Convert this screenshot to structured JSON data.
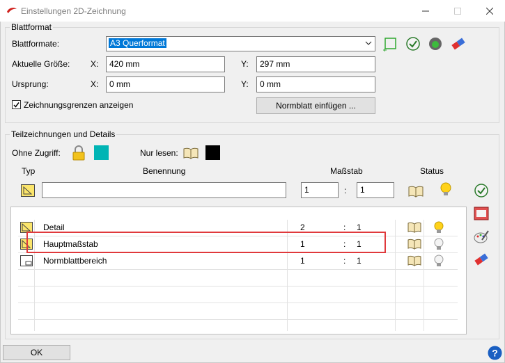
{
  "window": {
    "title": "Einstellungen 2D-Zeichnung"
  },
  "blattformat": {
    "legend": "Blattformat",
    "blattformate_label": "Blattformate:",
    "blattformate_value": "A3 Querformat",
    "aktuelle_groesse_label": "Aktuelle Größe:",
    "x_label": "X:",
    "y_label": "Y:",
    "groesse_x": "420 mm",
    "groesse_y": "297 mm",
    "ursprung_label": "Ursprung:",
    "ursprung_x": "0 mm",
    "ursprung_y": "0 mm",
    "grenzen_label": "Zeichnungsgrenzen anzeigen",
    "grenzen_checked": true,
    "normblatt_button": "Normblatt einfügen ..."
  },
  "teilzeichnungen": {
    "legend": "Teilzeichnungen und Details",
    "ohne_zugriff_label": "Ohne Zugriff:",
    "ohne_zugriff_color": "#00b4b4",
    "nur_lesen_label": "Nur lesen:",
    "nur_lesen_color": "#000000",
    "col_typ": "Typ",
    "col_benennung": "Benennung",
    "col_massstab": "Maßstab",
    "col_status": "Status",
    "new_name": "",
    "new_scale_a": "1",
    "new_scale_sep": ":",
    "new_scale_b": "1",
    "rows": [
      {
        "name": "Detail",
        "scale_a": "2",
        "sep": ":",
        "scale_b": "1",
        "bulb": "on"
      },
      {
        "name": "Hauptmaßstab",
        "scale_a": "1",
        "sep": ":",
        "scale_b": "1",
        "bulb": "off"
      },
      {
        "name": "Normblattbereich",
        "scale_a": "1",
        "sep": ":",
        "scale_b": "1",
        "bulb": "off"
      }
    ]
  },
  "footer": {
    "ok_button": "OK"
  }
}
